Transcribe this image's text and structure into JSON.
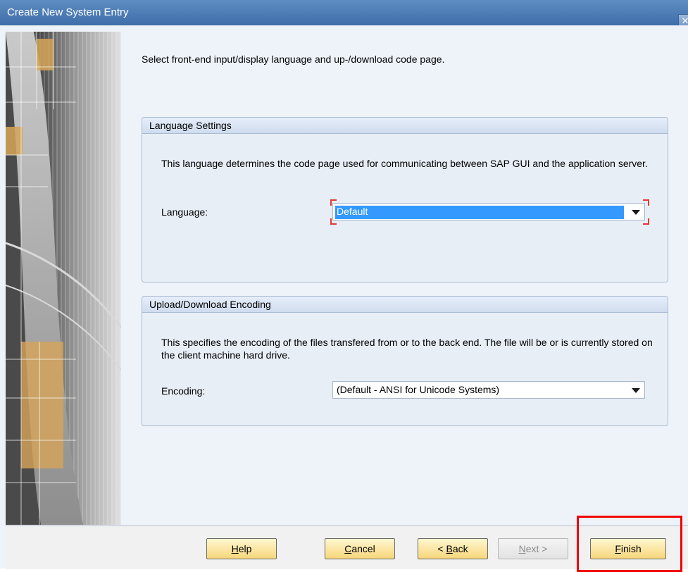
{
  "window": {
    "title": "Create New System Entry",
    "close_glyph": "✕"
  },
  "intro_text": "Select front-end input/display language and up-/download code page.",
  "language_group": {
    "heading": "Language Settings",
    "description": "This language determines the code page used for communicating between SAP GUI and the application server.",
    "field_label": "Language:",
    "value": "Default"
  },
  "encoding_group": {
    "heading": "Upload/Download Encoding",
    "description": "This specifies the encoding of the files transfered from or to the back end. The file will be or is currently stored on the client machine hard drive.",
    "field_label": "Encoding:",
    "value": "(Default - ANSI for Unicode Systems)"
  },
  "buttons": {
    "help": {
      "mnemonic": "H",
      "rest": "elp"
    },
    "cancel": {
      "mnemonic": "C",
      "rest": "ancel"
    },
    "back": {
      "prefix": "< ",
      "mnemonic": "B",
      "rest": "ack"
    },
    "next": {
      "mnemonic": "N",
      "rest": "ext >"
    },
    "finish": {
      "mnemonic": "F",
      "rest": "inish"
    }
  },
  "colors": {
    "highlight": "#f00000",
    "accent": "#3399ff",
    "required_marker": "#e23b2f"
  }
}
